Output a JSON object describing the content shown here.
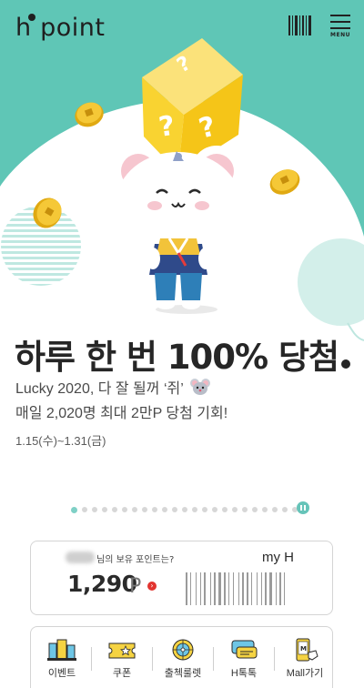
{
  "header": {
    "logo_mark": "h",
    "logo_text": "point",
    "barcode_icon": "barcode-icon",
    "menu_icon": "hamburger-menu-icon",
    "menu_label": "MENU"
  },
  "banner": {
    "headline": "하루 한 번 100% 당첨",
    "subtitle_line1": "Lucky 2020, 다 잘 될꺼 ‘쥐’",
    "subtitle_line2": "매일 2,020명 최대 2만P 당첨 기회!",
    "period": "1.15(수)~1.31(금)",
    "slide_count": 24,
    "active_slide": 1,
    "pause_icon": "pause-icon"
  },
  "points_card": {
    "label": "님의 보유 포인트는?",
    "value": "1,290",
    "unit": "P",
    "brand": "my H",
    "arrow_icon": "chevron-right-icon"
  },
  "quick_menu": [
    {
      "label": "이벤트",
      "icon": "event-building-icon"
    },
    {
      "label": "쿠폰",
      "icon": "coupon-ticket-icon"
    },
    {
      "label": "출첵룰렛",
      "icon": "roulette-wheel-icon"
    },
    {
      "label": "H톡톡",
      "icon": "chat-bubbles-icon"
    },
    {
      "label": "Mall가기",
      "icon": "mall-phone-icon"
    }
  ],
  "colors": {
    "teal": "#5fc6b6",
    "teal_light": "#bfe8e1",
    "yellow": "#f9d331",
    "red_arrow": "#e2342f",
    "pager_active": "#7fd0c6"
  }
}
